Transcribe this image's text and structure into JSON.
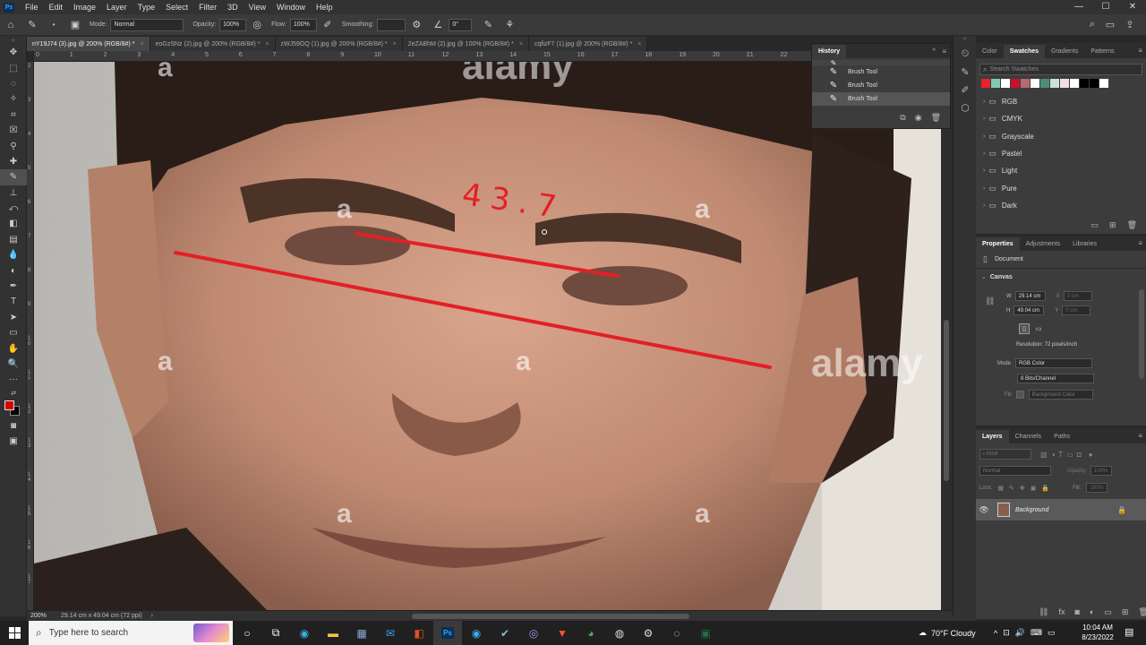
{
  "menubar": {
    "logo": "Ps",
    "items": [
      "File",
      "Edit",
      "Image",
      "Layer",
      "Type",
      "Select",
      "Filter",
      "3D",
      "View",
      "Window",
      "Help"
    ],
    "minimize": "—",
    "maximize": "☐",
    "close": "✕"
  },
  "options": {
    "mode_label": "Mode:",
    "mode_value": "Normal",
    "opacity_label": "Opacity:",
    "opacity_value": "100%",
    "flow_label": "Flow:",
    "flow_value": "100%",
    "smoothing_label": "Smoothing:",
    "angle_value": "0°"
  },
  "tabs": [
    {
      "label": "nY19J74 (3).jpg @ 200% (RGB/8#) *",
      "active": true
    },
    {
      "label": "eoGzSNz (2).jpg @ 200% (RGB/8#) *",
      "active": false
    },
    {
      "label": "zWJ59OQ (1).jpg @ 200% (RGB/8#) *",
      "active": false
    },
    {
      "label": "2eZABhM (2).jpg @ 100% (RGB/8#) *",
      "active": false
    },
    {
      "label": "cqfizF7 (1).jpg @ 200% (RGB/8#) *",
      "active": false
    }
  ],
  "ruler": {
    "h_ticks": [
      "0",
      "1",
      "2",
      "3",
      "4",
      "5",
      "6",
      "7",
      "8",
      "9",
      "10",
      "11",
      "12",
      "13",
      "14",
      "15",
      "16",
      "17",
      "18",
      "19",
      "20",
      "21",
      "22"
    ],
    "v_ticks": [
      "2",
      "3",
      "4",
      "5",
      "6",
      "7",
      "8",
      "9",
      "1 0",
      "1 1",
      "1 2",
      "1 3",
      "1 4",
      "1 5",
      "1 6",
      "1 7"
    ]
  },
  "canvas": {
    "annotation_text": "43.7",
    "watermark_small": "a",
    "watermark_brand": "alamy"
  },
  "history": {
    "title": "History",
    "items": [
      "Brush Tool",
      "Brush Tool",
      "Brush Tool"
    ]
  },
  "swatches": {
    "tabs": [
      "Color",
      "Swatches",
      "Gradients",
      "Patterns"
    ],
    "search_placeholder": "Search Swatches",
    "colors": [
      "#e8212a",
      "#7fcab6",
      "#ffffff",
      "#c8102e",
      "#b56b6b",
      "#ffffff",
      "#4a8f7a",
      "#c9e0dc",
      "#f0e0e0",
      "#ffffff",
      "#000000",
      "#000000",
      "#ffffff"
    ],
    "folders": [
      "RGB",
      "CMYK",
      "Grayscale",
      "Pastel",
      "Light",
      "Pure",
      "Dark"
    ]
  },
  "properties": {
    "tabs": [
      "Properties",
      "Adjustments",
      "Libraries"
    ],
    "document_label": "Document",
    "canvas_label": "Canvas",
    "w_label": "W",
    "w_value": "29.14 cm",
    "h_label": "H",
    "h_value": "49.04 cm",
    "x_label": "X",
    "y_label": "Y",
    "x_placeholder": "0 cm",
    "y_placeholder": "0 cm",
    "resolution": "Resolution: 72 pixels/inch",
    "mode_label": "Mode",
    "mode_value": "RGB Color",
    "bits_value": "8 Bits/Channel",
    "fill_label": "Fill",
    "fill_value": "Background Color"
  },
  "layers": {
    "tabs": [
      "Layers",
      "Channels",
      "Paths"
    ],
    "kind_placeholder": "Kind",
    "blend_mode": "Normal",
    "opacity_label": "Opacity:",
    "opacity_value": "100%",
    "lock_label": "Lock:",
    "fill_label": "Fill:",
    "fill_value": "100%",
    "layer_name": "Background"
  },
  "status": {
    "zoom": "200%",
    "doc_size": "29.14 cm x 49.04 cm (72 ppi)"
  },
  "taskbar": {
    "search_placeholder": "Type here to search",
    "weather": "70°F  Cloudy",
    "time": "10:04 AM",
    "date": "8/23/2022"
  },
  "colors": {
    "accent_red": "#e41f26",
    "foreground_swatch": "#d40000",
    "background_swatch": "#000000"
  }
}
